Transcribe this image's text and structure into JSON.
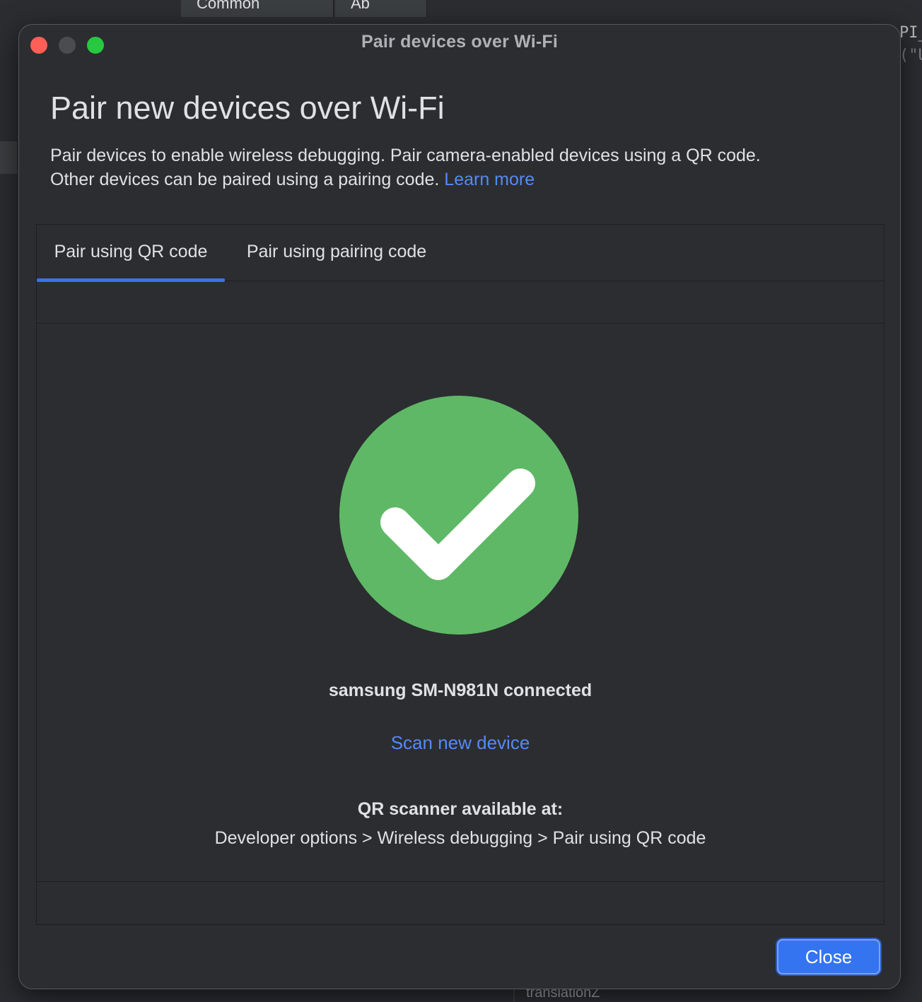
{
  "background": {
    "tabs": [
      "Common",
      "Ab"
    ],
    "right_text_lines": [
      "PI_",
      "(\"U"
    ],
    "bottom_label": "translationZ"
  },
  "window": {
    "title": "Pair devices over Wi-Fi"
  },
  "header": {
    "heading": "Pair new devices over Wi-Fi",
    "description_line1": "Pair devices to enable wireless debugging. Pair camera-enabled devices using a QR code.",
    "description_line2": "Other devices can be paired using a pairing code.",
    "learn_more": "Learn more"
  },
  "tabs": [
    {
      "label": "Pair using QR code",
      "selected": true
    },
    {
      "label": "Pair using pairing code",
      "selected": false
    }
  ],
  "status": {
    "icon": "check-circle-icon",
    "message": "samsung SM-N981N connected",
    "scan_link": "Scan new device",
    "qr_heading": "QR scanner available at:",
    "qr_path": "Developer options > Wireless debugging > Pair using QR code"
  },
  "footer": {
    "close_label": "Close"
  },
  "colors": {
    "accent": "#3574f0",
    "link": "#548af7",
    "success": "#5fb866",
    "dialog_bg": "#2b2d30"
  }
}
